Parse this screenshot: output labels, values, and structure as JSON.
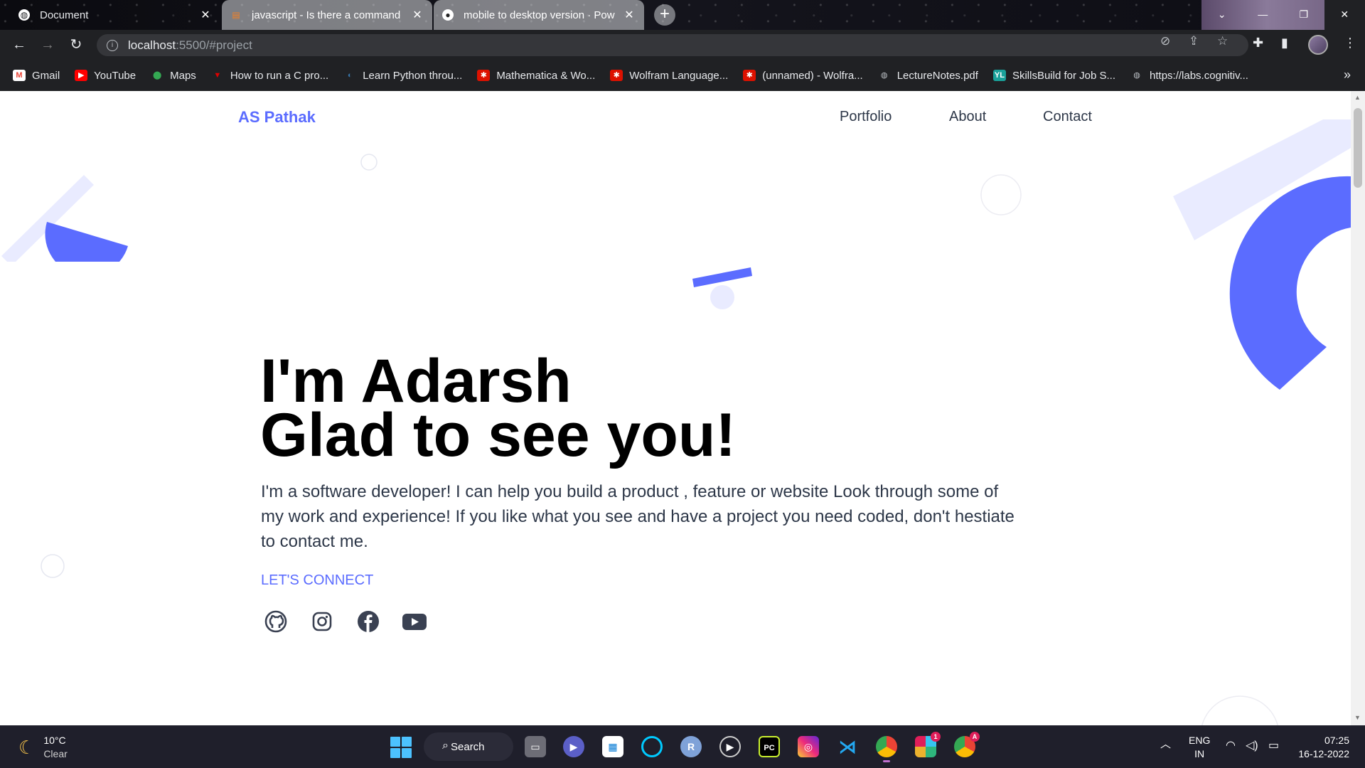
{
  "browser": {
    "tabs": [
      {
        "title": "Document",
        "active": true,
        "icon": "globe-icon"
      },
      {
        "title": "javascript - Is there a command",
        "active": false,
        "icon": "stackoverflow-icon"
      },
      {
        "title": "mobile to desktop version · Pow",
        "active": false,
        "icon": "github-icon"
      }
    ],
    "new_tab_label": "+",
    "url_host": "localhost",
    "url_rest": ":5500/#project",
    "bookmarks": [
      {
        "label": "Gmail",
        "icon": "gmail-icon",
        "color": "#ea4335"
      },
      {
        "label": "YouTube",
        "icon": "youtube-icon",
        "color": "#ff0000"
      },
      {
        "label": "Maps",
        "icon": "maps-icon",
        "color": "#34a853"
      },
      {
        "label": "How to run a C pro...",
        "icon": "vivaldi-icon",
        "color": "#e00000"
      },
      {
        "label": "Learn Python throu...",
        "icon": "python-icon",
        "color": "#3776ab"
      },
      {
        "label": "Mathematica & Wo...",
        "icon": "wolfram-icon",
        "color": "#dd1100"
      },
      {
        "label": "Wolfram Language...",
        "icon": "wolfram-icon",
        "color": "#dd1100"
      },
      {
        "label": "(unnamed) - Wolfra...",
        "icon": "wolfram-icon",
        "color": "#dd1100"
      },
      {
        "label": "LectureNotes.pdf",
        "icon": "globe-icon",
        "color": "#5f6368"
      },
      {
        "label": "SkillsBuild for Job S...",
        "icon": "skillsbuild-icon",
        "color": "#1aa19a"
      },
      {
        "label": "https://labs.cognitiv...",
        "icon": "globe-icon",
        "color": "#5f6368"
      }
    ]
  },
  "site": {
    "brand": "AS Pathak",
    "nav": [
      "Portfolio",
      "About",
      "Contact"
    ],
    "hero_line1": "I'm Adarsh",
    "hero_line2": "Glad to see you!",
    "intro": "I'm a software developer! I can help you build a product , feature or website Look through some of my work and experience! If you like what you see and have a project you need coded, don't hestiate to contact me.",
    "cta": "LET'S CONNECT",
    "socials": [
      "github-icon",
      "instagram-icon",
      "facebook-icon",
      "youtube-icon"
    ],
    "accent": "#5b6cff",
    "accent_light": "#e9ebff"
  },
  "taskbar": {
    "temp": "10°C",
    "condition": "Clear",
    "search_label": "Search",
    "lang_top": "ENG",
    "lang_bottom": "IN",
    "time": "07:25",
    "date": "16-12-2022",
    "apps": [
      {
        "name": "task-view-icon"
      },
      {
        "name": "teams-icon"
      },
      {
        "name": "store-icon"
      },
      {
        "name": "alexa-icon"
      },
      {
        "name": "r-icon",
        "label": "R"
      },
      {
        "name": "media-player-icon"
      },
      {
        "name": "pycharm-icon",
        "label": "PC"
      },
      {
        "name": "instagram-icon"
      },
      {
        "name": "vscode-icon"
      },
      {
        "name": "chrome-icon"
      },
      {
        "name": "slack-icon",
        "badge": "1"
      },
      {
        "name": "chrome-profile-icon",
        "badge": "A"
      }
    ]
  }
}
